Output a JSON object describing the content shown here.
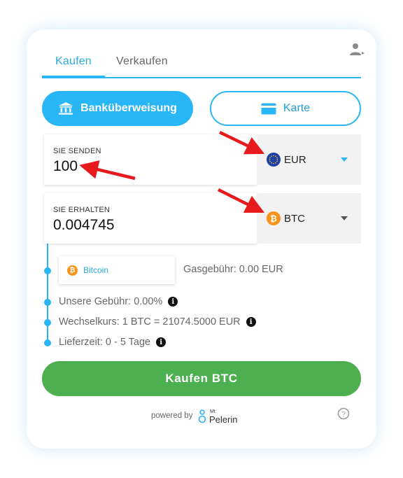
{
  "tabs": [
    {
      "label": "Kaufen",
      "active": true
    },
    {
      "label": "Verkaufen",
      "active": false
    }
  ],
  "payment_methods": {
    "bank": {
      "label": "Banküberweisung",
      "icon": "bank-icon",
      "selected": true
    },
    "card": {
      "label": "Karte",
      "icon": "credit-card-icon",
      "selected": false
    }
  },
  "send": {
    "label": "SIE SENDEN",
    "value": "100",
    "currency": "EUR",
    "currency_icon": "eu-flag-icon"
  },
  "receive": {
    "label": "SIE ERHALTEN",
    "value": "0.004745",
    "currency": "BTC",
    "currency_icon": "bitcoin-icon"
  },
  "network": {
    "label": "Bitcoin",
    "gas_fee": "Gasgebühr: 0.00 EUR"
  },
  "details": {
    "fee": "Unsere Gebühr: 0.00%",
    "rate": "Wechselkurs: 1 BTC = 21074.5000 EUR",
    "delivery": "Lieferzeit: 0 - 5 Tage"
  },
  "buy_button": {
    "label": "Kaufen BTC"
  },
  "footer": {
    "powered_by": "powered by",
    "brand_small": "Mt",
    "brand": "Pelerin"
  },
  "colors": {
    "accent": "#29b6f6",
    "buy": "#4caf50",
    "annotation_arrow": "#e8191d",
    "btc": "#f7931a",
    "eur": "#1f3fa8"
  }
}
